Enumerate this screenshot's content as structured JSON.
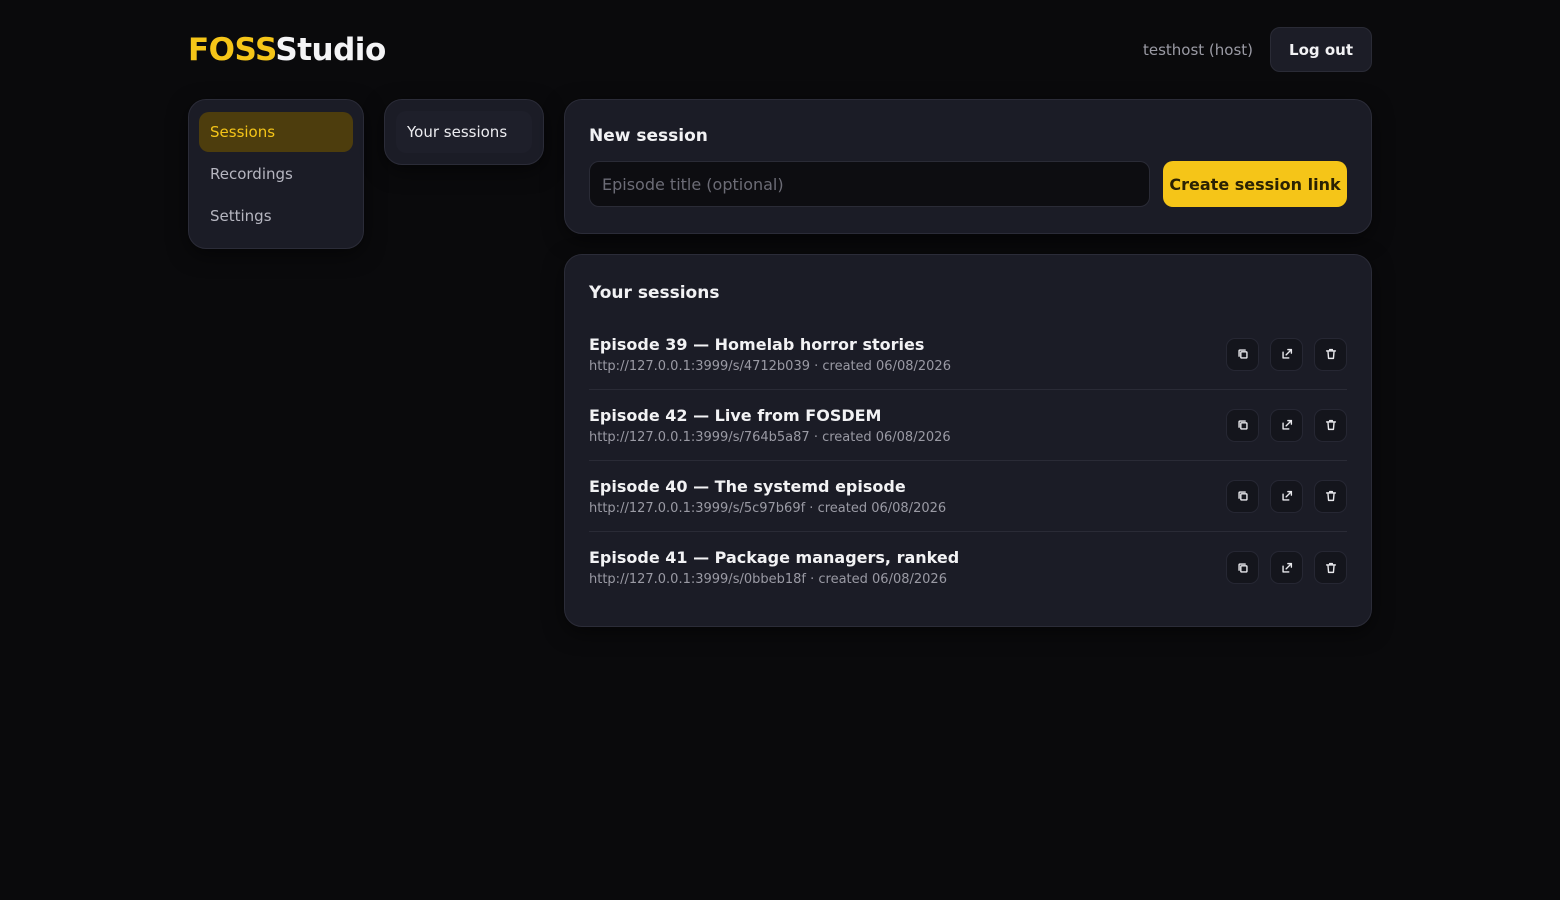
{
  "app": {
    "logo_accent": "FOSS",
    "logo_rest": "Studio"
  },
  "header": {
    "user": "testhost (host)",
    "logout_label": "Log out"
  },
  "nav": {
    "items": [
      {
        "label": "Sessions",
        "active": true
      },
      {
        "label": "Recordings",
        "active": false
      },
      {
        "label": "Settings",
        "active": false
      }
    ]
  },
  "subnav": {
    "item": "Your sessions"
  },
  "new_session": {
    "title": "New session",
    "input_placeholder": "Episode title (optional)",
    "input_value": "",
    "create_label": "Create session link"
  },
  "sessions": {
    "title": "Your sessions",
    "rows": [
      {
        "title": "Episode 39 — Homelab horror stories",
        "meta": "http://127.0.0.1:3999/s/4712b039 · created 06/08/2026"
      },
      {
        "title": "Episode 42 — Live from FOSDEM",
        "meta": "http://127.0.0.1:3999/s/764b5a87 · created 06/08/2026"
      },
      {
        "title": "Episode 40 — The systemd episode",
        "meta": "http://127.0.0.1:3999/s/5c97b69f · created 06/08/2026"
      },
      {
        "title": "Episode 41 — Package managers, ranked",
        "meta": "http://127.0.0.1:3999/s/0bbeb18f · created 06/08/2026"
      }
    ],
    "row_icons": [
      "copy-icon",
      "open-external-icon",
      "trash-icon"
    ]
  },
  "colors": {
    "accent": "#f5c518",
    "background": "#0a0a0c",
    "card": "#1b1c26"
  }
}
